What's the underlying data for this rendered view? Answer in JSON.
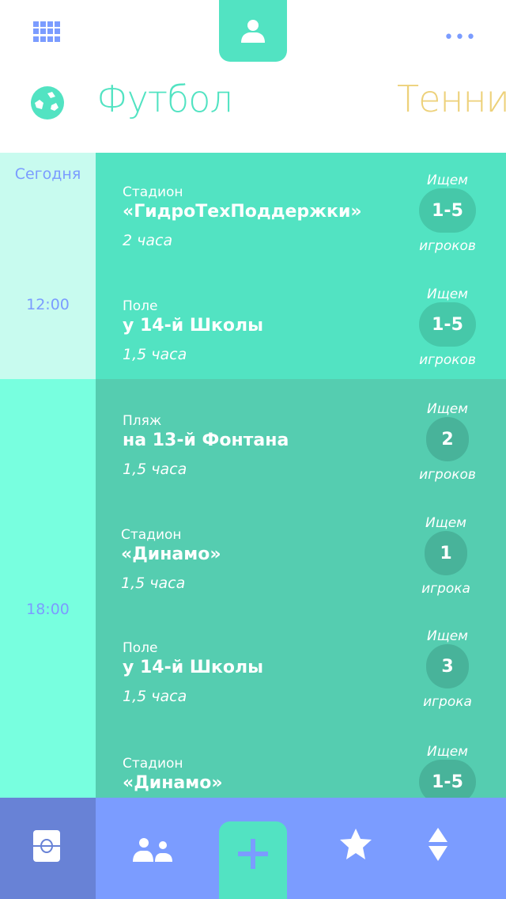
{
  "header": {
    "menu_icon": "grid-icon",
    "profile_icon": "user-icon",
    "more_icon": "more-dots-icon",
    "sport_icon": "soccer-ball-icon",
    "current_sport": "Футбол",
    "next_sport": "Тенни"
  },
  "timeline": {
    "today": "Сегодня",
    "slots": [
      "12:00",
      "18:00"
    ]
  },
  "games": [
    {
      "type": "Стадион",
      "name": "«ГидроТехПоддержки»",
      "duration": "2 часа",
      "seek": "Ищем",
      "count": "1-5",
      "players": "игроков"
    },
    {
      "type": "Поле",
      "name": "у 14-й Школы",
      "duration": "1,5 часа",
      "seek": "Ищем",
      "count": "1-5",
      "players": "игроков"
    },
    {
      "type": "Пляж",
      "name": "на 13-й Фонтана",
      "duration": "1,5 часа",
      "seek": "Ищем",
      "count": "2",
      "players": "игроков"
    },
    {
      "type": "Стадион",
      "name": "«Динамо»",
      "duration": "1,5 часа",
      "seek": "Ищем",
      "count": "1",
      "players": "игрока"
    },
    {
      "type": "Поле",
      "name": "у 14-й Школы",
      "duration": "1,5 часа",
      "seek": "Ищем",
      "count": "3",
      "players": "игрока"
    },
    {
      "type": "Стадион",
      "name": "«Динамо»",
      "duration": "",
      "seek": "Ищем",
      "count": "1-5",
      "players": ""
    }
  ],
  "colors": {
    "accent": "#52E3C2",
    "blue": "#7B9CFF",
    "tennis": "#EDD17A",
    "active_tab": "#6882D6"
  },
  "tabbar": {
    "icons": [
      "field-icon",
      "friends-icon",
      "plus-icon",
      "star-icon",
      "sort-icon"
    ]
  }
}
